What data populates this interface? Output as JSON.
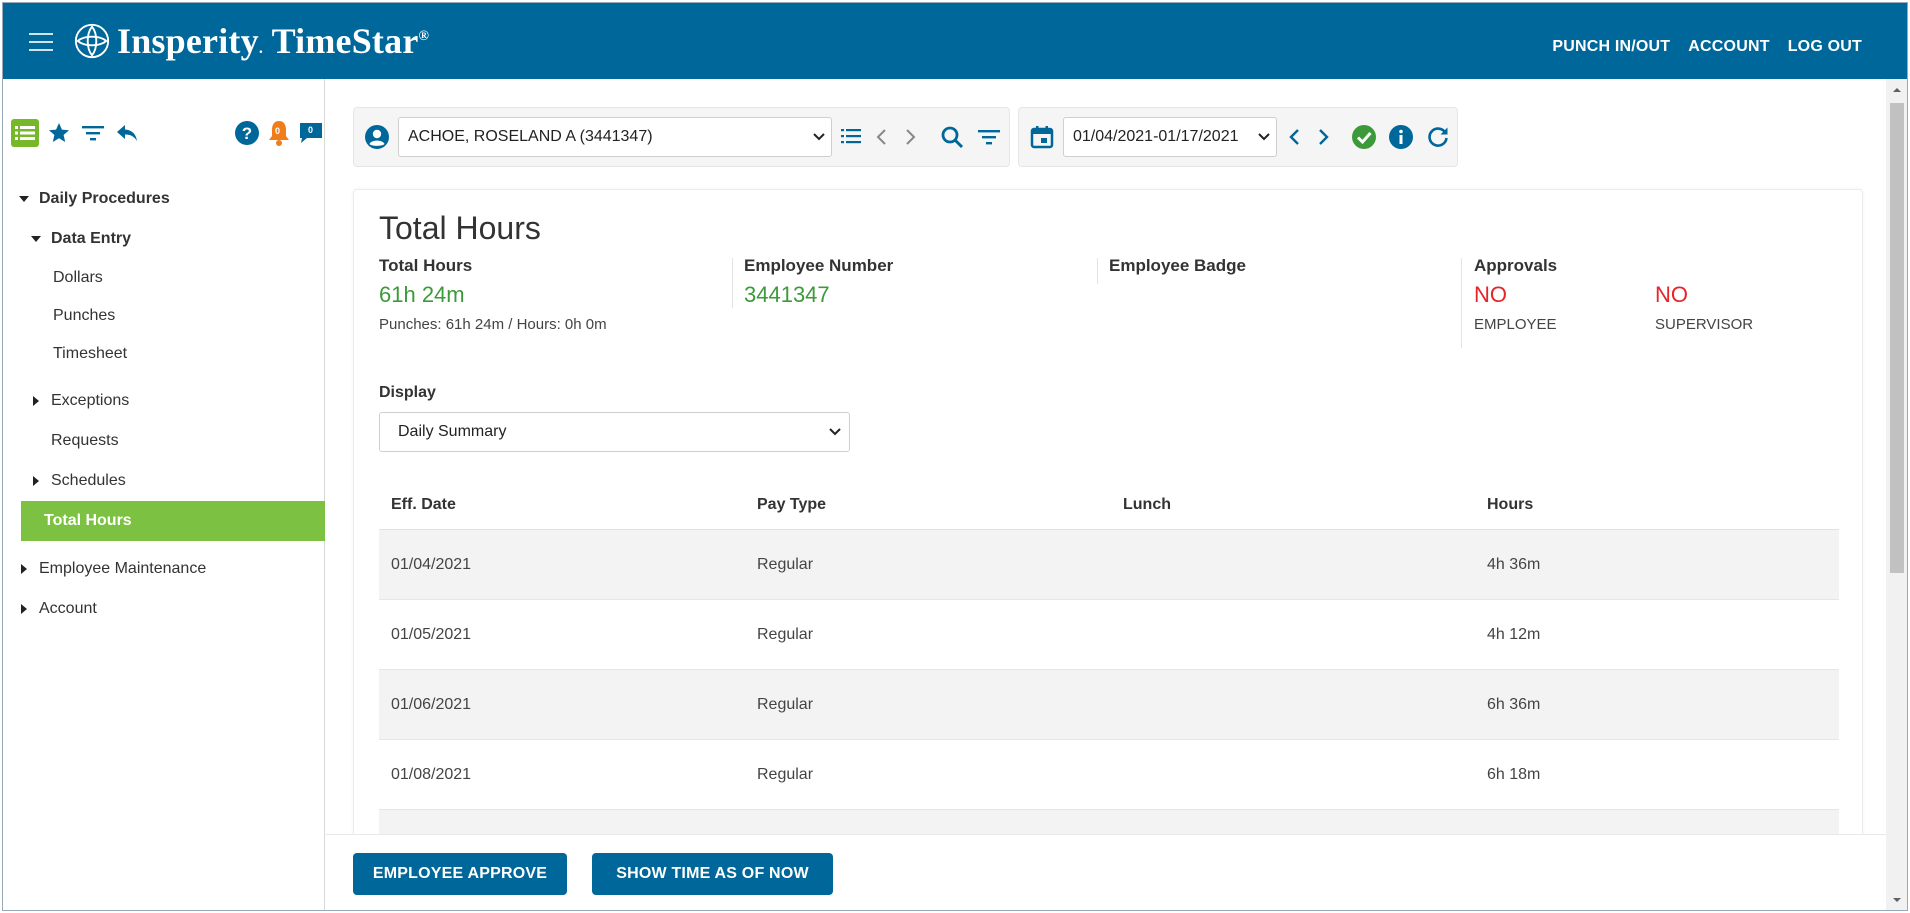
{
  "header": {
    "brand": "Insperity",
    "product": "TimeStar",
    "registered": "®",
    "nav": [
      "PUNCH IN/OUT",
      "ACCOUNT",
      "LOG OUT"
    ]
  },
  "sidebar": {
    "badges": {
      "alerts": "0",
      "messages": "0"
    },
    "tree": [
      {
        "label": "Daily Procedures",
        "level": 0,
        "caret": "down",
        "bold": true
      },
      {
        "label": "Data Entry",
        "level": 1,
        "caret": "down",
        "bold": true
      },
      {
        "label": "Dollars",
        "level": 2
      },
      {
        "label": "Punches",
        "level": 2
      },
      {
        "label": "Timesheet",
        "level": 2
      },
      {
        "label": "Exceptions",
        "level": 1,
        "caret": "right"
      },
      {
        "label": "Requests",
        "level": 1
      },
      {
        "label": "Schedules",
        "level": 1,
        "caret": "right"
      },
      {
        "label": "Total Hours",
        "level": 1,
        "active": true
      },
      {
        "label": "Employee Maintenance",
        "level": 0,
        "caret": "right"
      },
      {
        "label": "Account",
        "level": 0,
        "caret": "right"
      }
    ]
  },
  "toolbar": {
    "employee": "ACHOE, ROSELAND A (3441347)",
    "date_range": "01/04/2021-01/17/2021"
  },
  "main": {
    "title": "Total Hours",
    "total_hours": {
      "label": "Total Hours",
      "value": "61h 24m",
      "sub": "Punches: 61h 24m / Hours: 0h 0m"
    },
    "employee_number": {
      "label": "Employee Number",
      "value": "3441347"
    },
    "employee_badge": {
      "label": "Employee Badge"
    },
    "approvals": {
      "label": "Approvals",
      "employee": {
        "value": "NO",
        "caption": "EMPLOYEE"
      },
      "supervisor": {
        "value": "NO",
        "caption": "SUPERVISOR"
      }
    },
    "display": {
      "label": "Display",
      "selected": "Daily Summary"
    },
    "table": {
      "columns": [
        "Eff. Date",
        "Pay Type",
        "Lunch",
        "Hours"
      ],
      "rows": [
        {
          "date": "01/04/2021",
          "pay_type": "Regular",
          "lunch": "",
          "hours": "4h  36m"
        },
        {
          "date": "01/05/2021",
          "pay_type": "Regular",
          "lunch": "",
          "hours": "4h  12m"
        },
        {
          "date": "01/06/2021",
          "pay_type": "Regular",
          "lunch": "",
          "hours": "6h  36m"
        },
        {
          "date": "01/08/2021",
          "pay_type": "Regular",
          "lunch": "",
          "hours": "6h  18m"
        }
      ]
    }
  },
  "footer": {
    "approve_label": "EMPLOYEE APPROVE",
    "show_time_label": "SHOW TIME AS OF NOW"
  },
  "colors": {
    "header_bg": "#00679a",
    "active_green": "#7dc142",
    "value_green": "#3d9a3a",
    "no_red": "#e52528"
  }
}
